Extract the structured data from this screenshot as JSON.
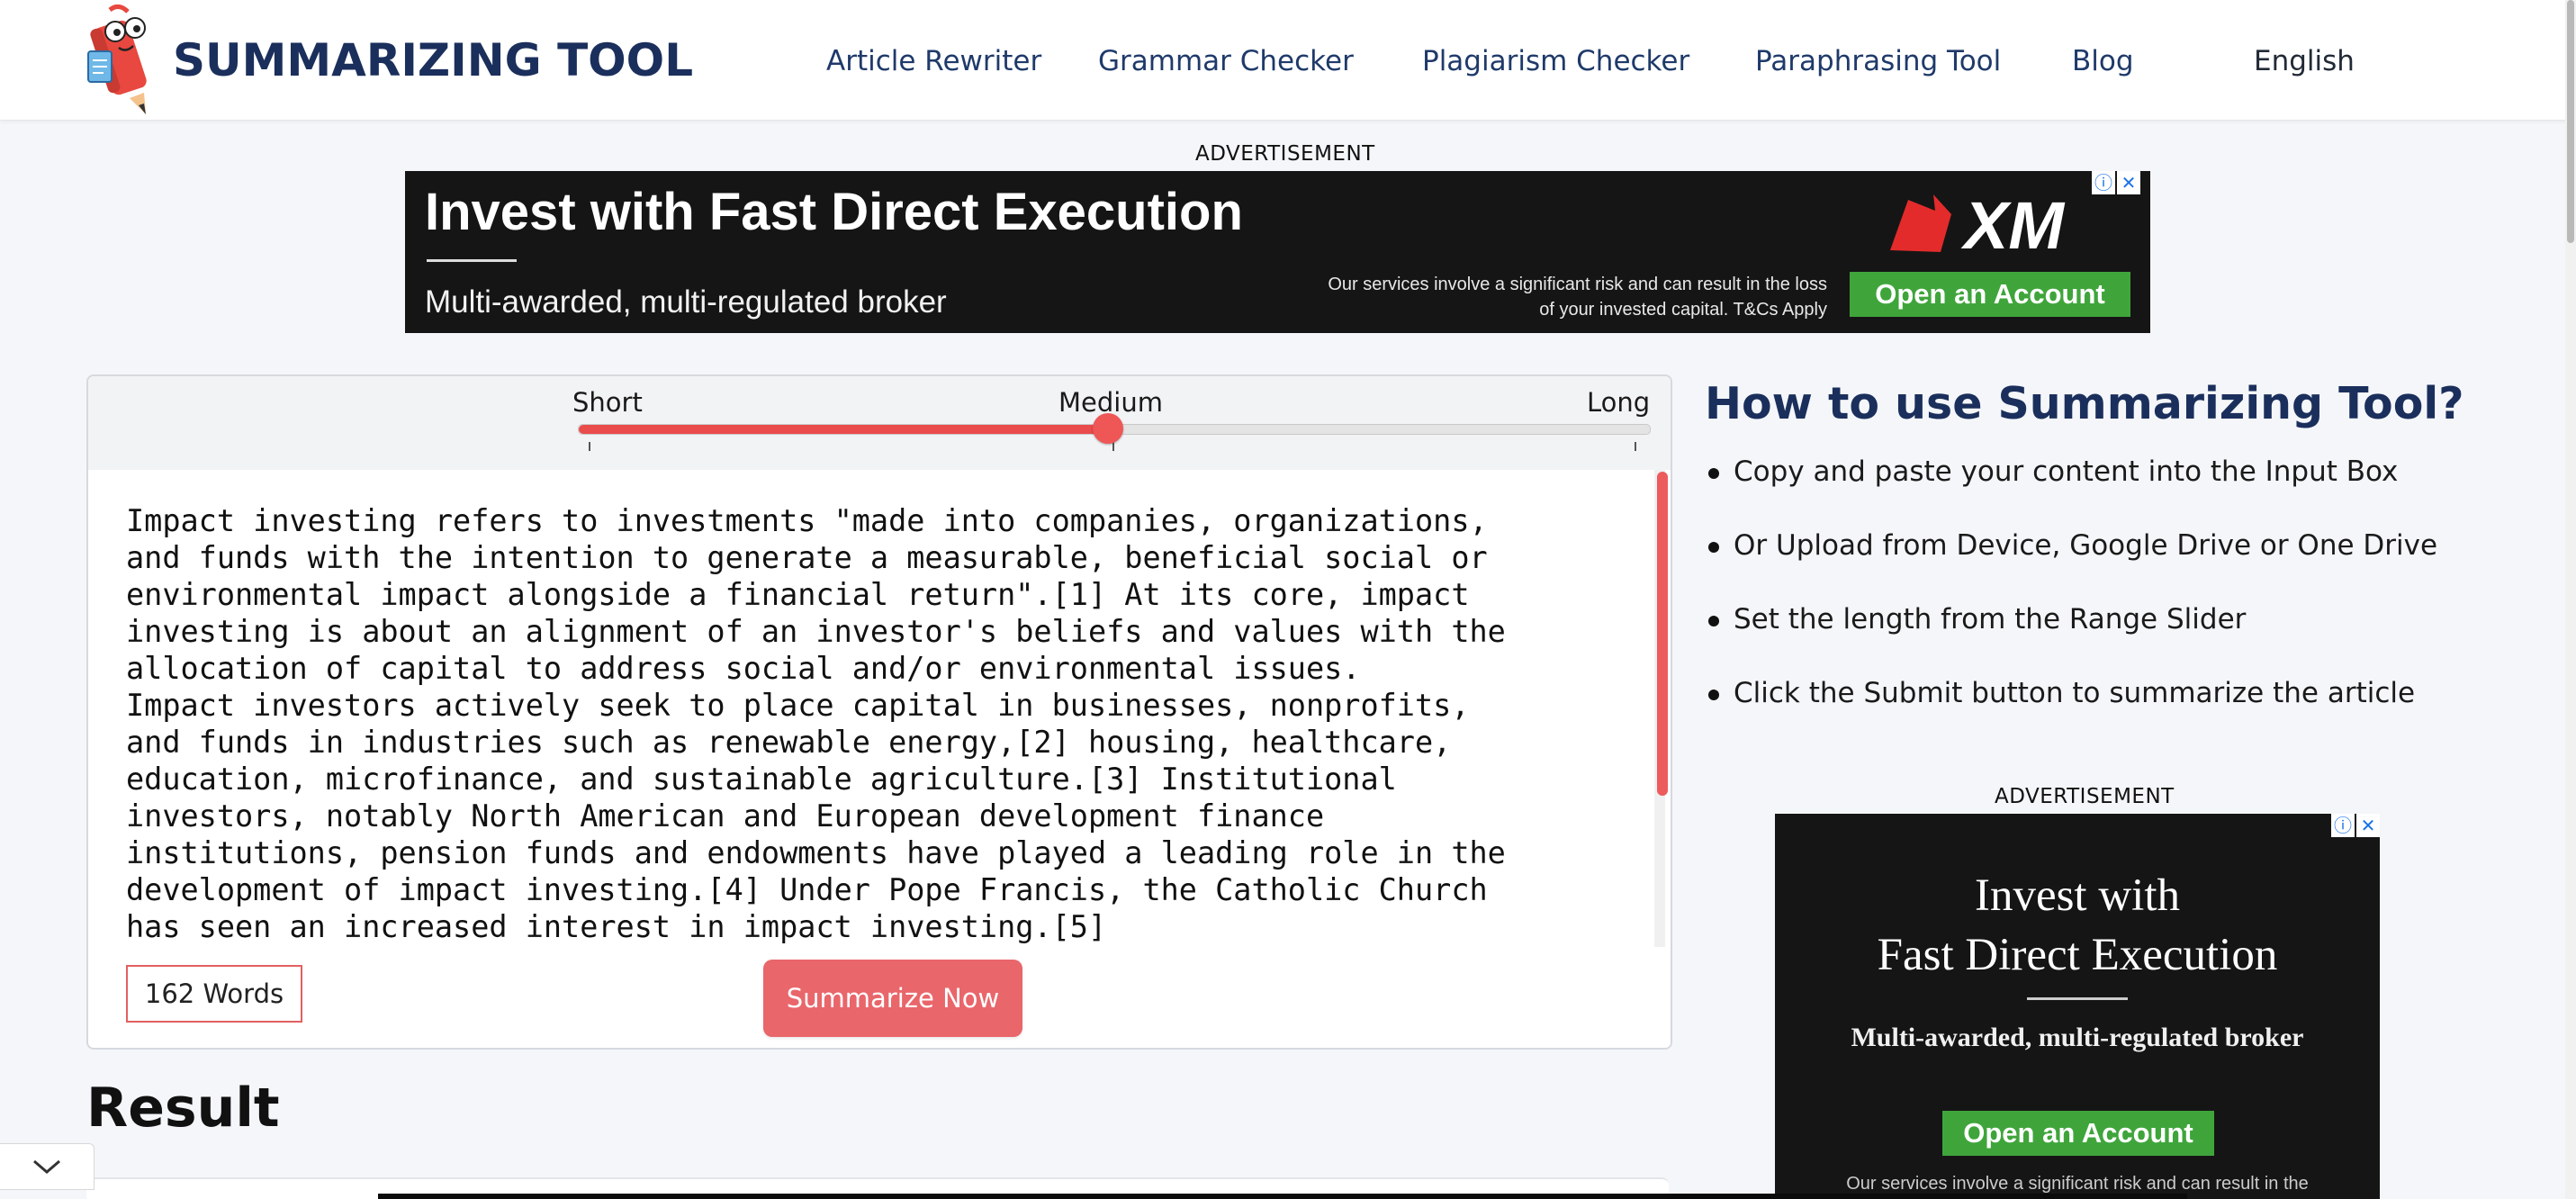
{
  "header": {
    "logo_text": "SUMMARIZING TOOL",
    "nav": [
      {
        "label": "Article Rewriter"
      },
      {
        "label": "Grammar Checker"
      },
      {
        "label": "Plagiarism Checker"
      },
      {
        "label": "Paraphrasing Tool"
      },
      {
        "label": "Blog"
      }
    ],
    "language": "English"
  },
  "ad_top": {
    "label": "ADVERTISEMENT",
    "headline": "Invest with Fast Direct Execution",
    "subline": "Multi-awarded, multi-regulated broker",
    "disclaimer": "Our services involve a significant risk and can result in the loss of your invested capital. T&Cs Apply",
    "cta": "Open an Account",
    "brand": "XM"
  },
  "summarizer": {
    "length_options": [
      "Short",
      "Medium",
      "Long"
    ],
    "selected_length": "Medium",
    "slider_value_fraction": 0.5,
    "input_text": "Impact investing refers to investments \"made into companies, organizations,\nand funds with the intention to generate a measurable, beneficial social or\nenvironmental impact alongside a financial return\".[1] At its core, impact\ninvesting is about an alignment of an investor's beliefs and values with the\nallocation of capital to address social and/or environmental issues.\nImpact investors actively seek to place capital in businesses, nonprofits,\nand funds in industries such as renewable energy,[2] housing, healthcare,\neducation, microfinance, and sustainable agriculture.[3] Institutional\ninvestors, notably North American and European development finance\ninstitutions, pension funds and endowments have played a leading role in the\ndevelopment of impact investing.[4] Under Pope Francis, the Catholic Church\nhas seen an increased interest in impact investing.[5]",
    "word_count": "162 Words",
    "submit_label": "Summarize Now"
  },
  "result": {
    "title": "Result"
  },
  "howto": {
    "title": "How to use Summarizing Tool?",
    "steps": [
      "Copy and paste your content into the Input Box",
      "Or Upload from Device, Google Drive or One Drive",
      "Set the length from the Range Slider",
      "Click the Submit button to summarize the article"
    ]
  },
  "ad_side": {
    "label": "ADVERTISEMENT",
    "headline_line1": "Invest with",
    "headline_line2": "Fast Direct Execution",
    "subline": "Multi-awarded, multi-regulated broker",
    "cta": "Open an Account",
    "disclaimer": "Our services involve a significant risk and can result in the"
  },
  "colors": {
    "brand_navy": "#1b2f5c",
    "accent_red": "#ea4b4b",
    "button_red": "#e9666b",
    "ad_green": "#3fa53b"
  }
}
